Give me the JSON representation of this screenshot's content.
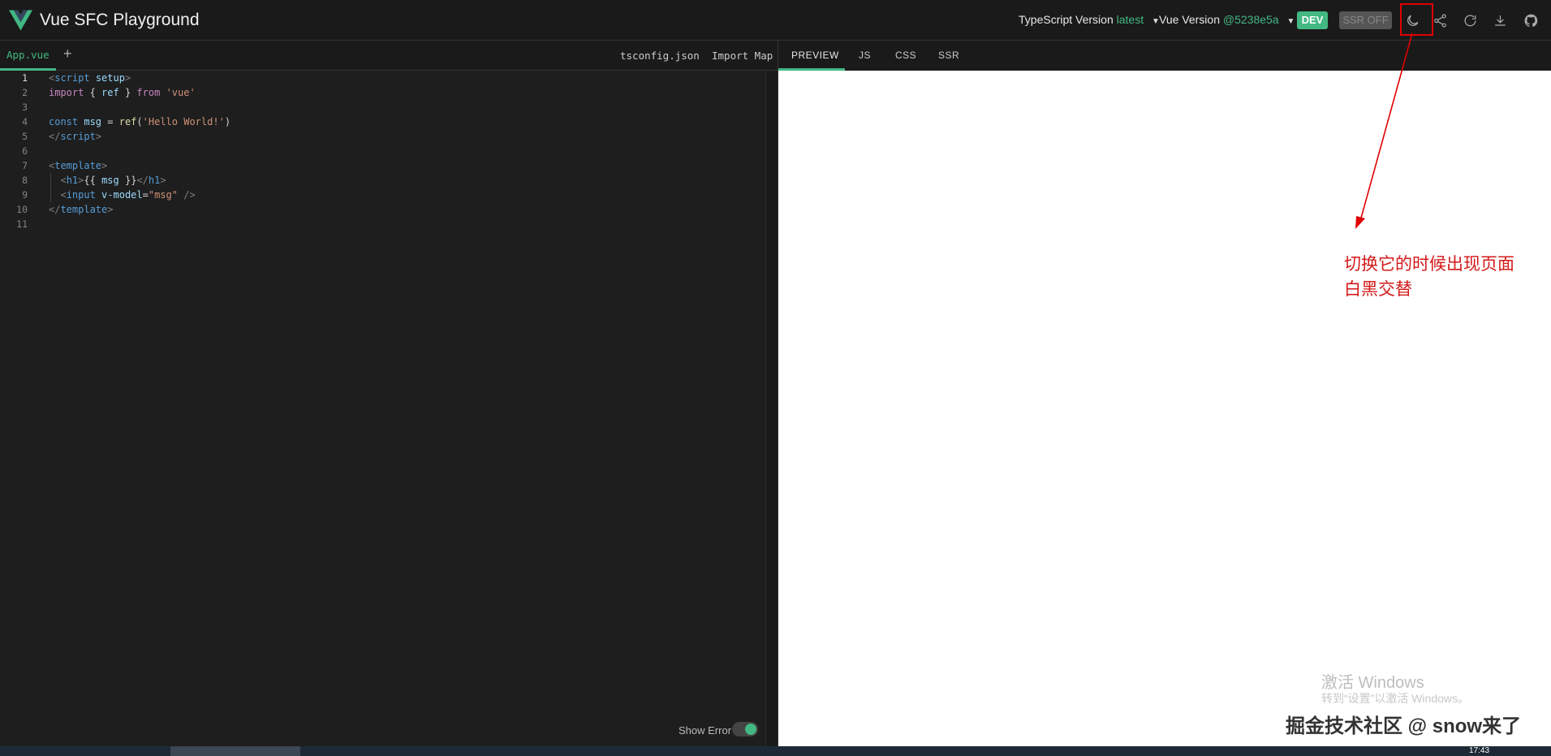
{
  "header": {
    "title": "Vue SFC Playground",
    "ts_version_label": "TypeScript Version",
    "ts_version_value": "latest",
    "vue_version_label": "Vue Version",
    "vue_version_value": "@5238e5a",
    "dev_badge": "DEV",
    "ssr_badge": "SSR OFF",
    "icons": [
      "theme-toggle-icon",
      "share-icon",
      "reload-icon",
      "download-icon",
      "github-icon"
    ]
  },
  "editor": {
    "active_file": "App.vue",
    "add_file": "+",
    "right_tabs": [
      "tsconfig.json",
      "Import Map"
    ],
    "line_numbers": [
      "1",
      "2",
      "3",
      "4",
      "5",
      "6",
      "7",
      "8",
      "9",
      "10",
      "11"
    ],
    "show_error_label": "Show Error",
    "show_error_on": true
  },
  "output": {
    "tabs": [
      "PREVIEW",
      "JS",
      "CSS",
      "SSR"
    ],
    "active_tab": "PREVIEW"
  },
  "annotation": {
    "line1": "切换它的时候出现页面",
    "line2": "白黑交替"
  },
  "overlay": {
    "activate_windows": "激活 Windows",
    "activate_hint": "转到“设置”以激活 Windows。",
    "watermark": "掘金技术社区 @ snow来了"
  },
  "taskbar": {
    "clock": "17:43"
  },
  "colors": {
    "accent": "#42b883",
    "annotation": "#d41a1a"
  }
}
